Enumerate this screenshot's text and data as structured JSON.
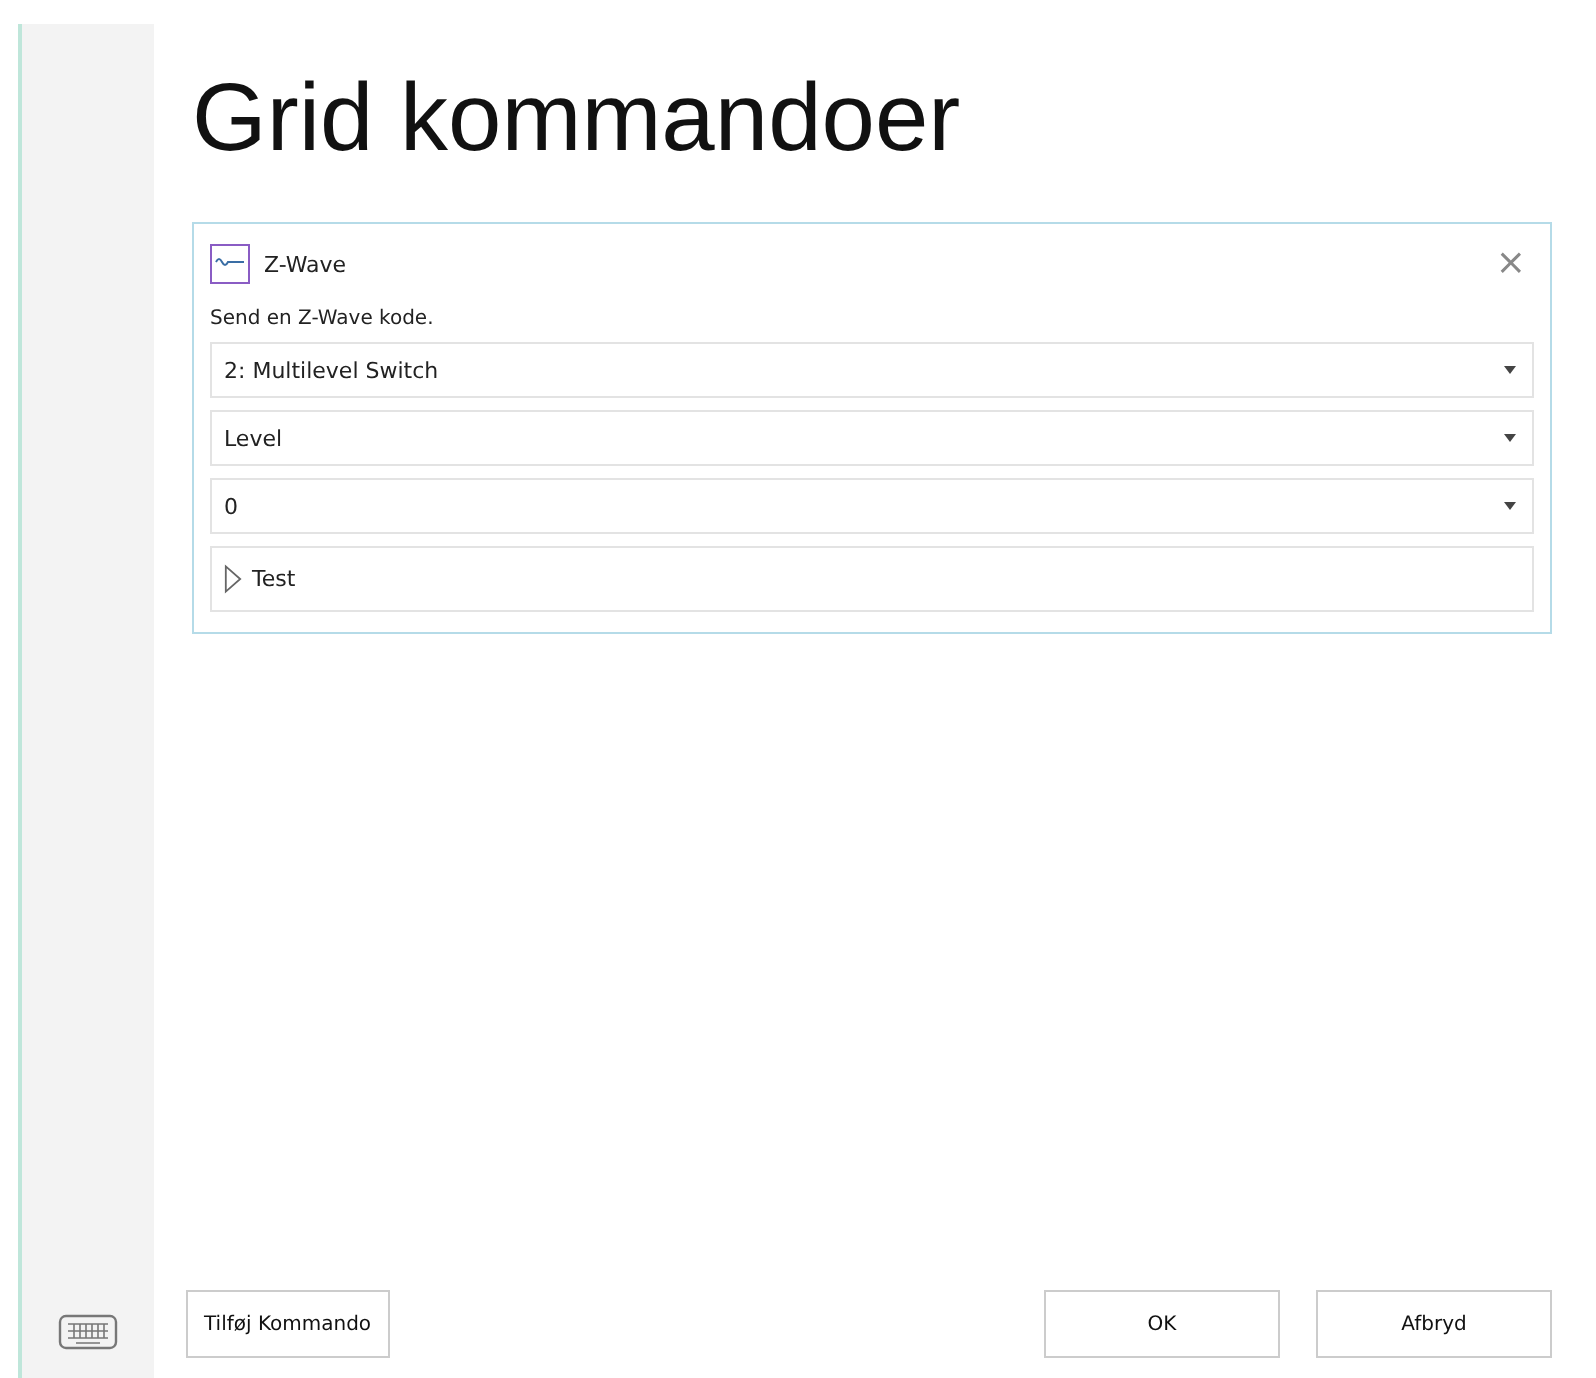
{
  "title": "Grid kommandoer",
  "card": {
    "title": "Z-Wave",
    "description": "Send en Z-Wave kode.",
    "close": "×",
    "fields": [
      {
        "kind": "dropdown",
        "value": "2: Multilevel Switch"
      },
      {
        "kind": "dropdown",
        "value": "Level"
      },
      {
        "kind": "dropdown",
        "value": "0"
      },
      {
        "kind": "action",
        "value": "Test"
      }
    ]
  },
  "footer": {
    "add_button": "Tilføj Kommando",
    "ok_button": "OK",
    "cancel_button": "Afbryd"
  }
}
